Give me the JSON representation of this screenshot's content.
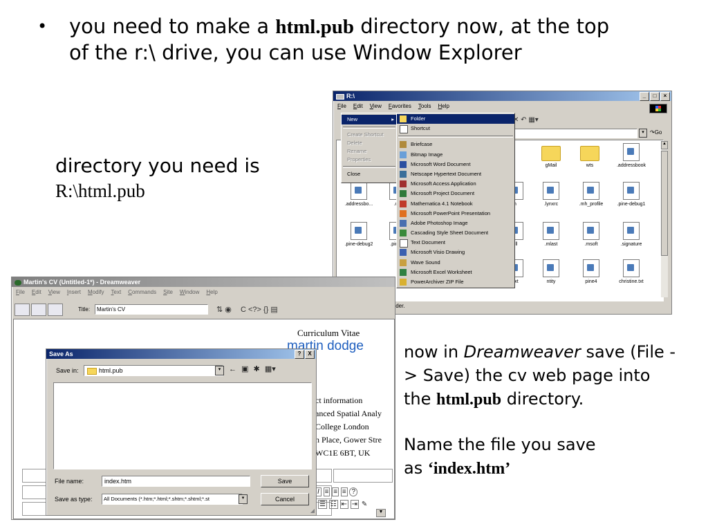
{
  "slide": {
    "bullet_pre": "you need to make a ",
    "bullet_code": "html.pub",
    "bullet_post": " directory now, at the top of the r:\\ drive, you can use Window Explorer",
    "dir_label": "directory you need is",
    "dir_path": "R:\\html.pub",
    "note1_pre": "now in ",
    "note1_app": "Dreamweaver",
    "note1_mid": " save (File -> Save) the cv web page into the ",
    "note1_code": "html.pub",
    "note1_post": " directory.",
    "note2_pre": "Name the file you save as ",
    "note2_q1": "‘",
    "note2_code": "index.htm",
    "note2_q2": "’"
  },
  "explorer": {
    "title": "R:\\",
    "menus": [
      "File",
      "Edit",
      "View",
      "Favorites",
      "Tools",
      "Help"
    ],
    "go_label": "Go",
    "status": "older.",
    "file_menu": [
      "New",
      "Create Shortcut",
      "Delete",
      "Rename",
      "Properties",
      "Close"
    ],
    "new_menu": [
      "Folder",
      "Shortcut",
      "Briefcase",
      "Bitmap Image",
      "Microsoft Word Document",
      "Netscape Hypertext Document",
      "Microsoft Access Application",
      "Microsoft Project Document",
      "Mathematica 4.1 Notebook",
      "Microsoft PowerPoint Presentation",
      "Adobe Photoshop Image",
      "Cascading Style Sheet Document",
      "Text Document",
      "Microsoft Visio Drawing",
      "Wave Sound",
      "Microsoft Excel Worksheet",
      "PowerArchiver ZIP File"
    ],
    "files": [
      {
        "name": "gMail",
        "type": "folder"
      },
      {
        "name": "wts",
        "type": "folder"
      },
      {
        "name": ".addressbook",
        "type": "file"
      },
      {
        "name": ".addressbo...",
        "type": "file"
      },
      {
        "name": ".csf",
        "type": "file"
      },
      {
        "name": "h",
        "type": "file"
      },
      {
        "name": ".lynxrc",
        "type": "file"
      },
      {
        "name": ".mh_profile",
        "type": "file"
      },
      {
        "name": ".pine-debug1",
        "type": "file"
      },
      {
        "name": ".pine-debug2",
        "type": "file"
      },
      {
        "name": ".pine-d",
        "type": "file"
      },
      {
        "name": "ull",
        "type": "file"
      },
      {
        "name": ".mlast",
        "type": "file"
      },
      {
        "name": ".msoft",
        "type": "file"
      },
      {
        "name": ".signature",
        "type": "file"
      },
      {
        "name": ".txt",
        "type": "file"
      },
      {
        "name": "ntity",
        "type": "file"
      },
      {
        "name": "pine4",
        "type": "file"
      },
      {
        "name": "christine.txt",
        "type": "file"
      }
    ]
  },
  "dreamweaver": {
    "title": "Martin's CV (Untitled-1*) - Dreamweaver",
    "menus": [
      "File",
      "Edit",
      "View",
      "Insert",
      "Modify",
      "Text",
      "Commands",
      "Site",
      "Window",
      "Help"
    ],
    "title_label": "Title:",
    "title_value": "Martin's CV",
    "doc_heading": "Curriculum Vitae",
    "doc_name": "martin dodge",
    "doc_lines": [
      "ct information",
      "anced Spatial Analy",
      "College London",
      "n Place, Gower Stre",
      "WC1E 6BT, UK"
    ]
  },
  "save_dialog": {
    "title": "Save As",
    "save_in_label": "Save in:",
    "save_in_value": "html.pub",
    "filename_label": "File name:",
    "filename_value": "index.htm",
    "savetype_label": "Save as type:",
    "savetype_value": "All Documents (*.htm;*.html;*.shtm;*.shtml;*.st",
    "save_button": "Save",
    "cancel_button": "Cancel",
    "help_button": "?",
    "close_button": "X"
  }
}
